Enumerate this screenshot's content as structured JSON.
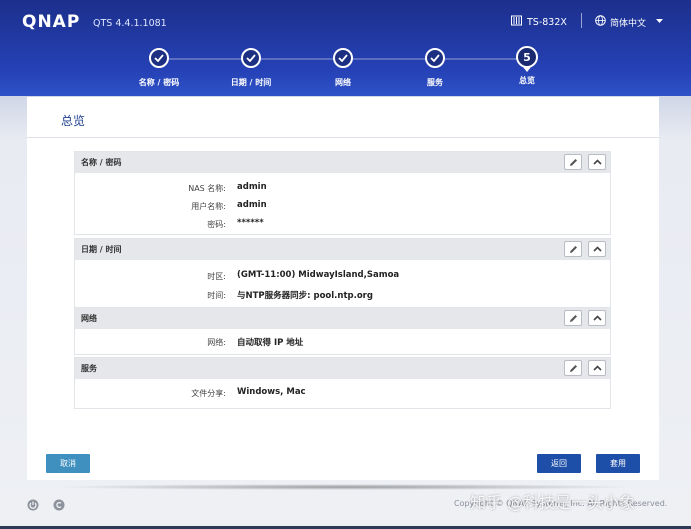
{
  "header": {
    "logo": "QNAP",
    "version": "QTS 4.4.1.1081",
    "model": "TS-832X",
    "language": "简体中文"
  },
  "wizard": {
    "steps": [
      {
        "label": "名称 / 密码",
        "state": "done"
      },
      {
        "label": "日期 / 时间",
        "state": "done"
      },
      {
        "label": "网络",
        "state": "done"
      },
      {
        "label": "服务",
        "state": "done"
      },
      {
        "label": "总览",
        "state": "active",
        "number": "5"
      }
    ]
  },
  "panel": {
    "title": "总览",
    "sections": [
      {
        "title": "名称 / 密码",
        "rows": [
          {
            "key": "NAS 名称:",
            "value": "admin"
          },
          {
            "key": "用户名称:",
            "value": "admin"
          },
          {
            "key": "密码:",
            "value": "******"
          }
        ]
      },
      {
        "title": "日期 / 时间",
        "rows": [
          {
            "key": "时区:",
            "value": "(GMT-11:00) MidwayIsland,Samoa"
          },
          {
            "key": "时间:",
            "value": "与NTP服务器同步:  pool.ntp.org"
          }
        ]
      },
      {
        "title": "网络",
        "rows": [
          {
            "key": "网络:",
            "value": "自动取得 IP 地址"
          }
        ]
      },
      {
        "title": "服务",
        "rows": [
          {
            "key": "文件分享:",
            "value": "Windows, Mac"
          }
        ]
      }
    ]
  },
  "buttons": {
    "cancel": "取消",
    "back": "返回",
    "apply": "套用"
  },
  "footer": {
    "copyright": "Copyright © QNAP Systems, Inc. All Rights Reserved.",
    "watermark": "知乎 @科技是一头小象"
  },
  "colors": {
    "header_blue": "#2541b5",
    "primary_button": "#1e4fa8",
    "cancel_button": "#3f8fbf"
  }
}
